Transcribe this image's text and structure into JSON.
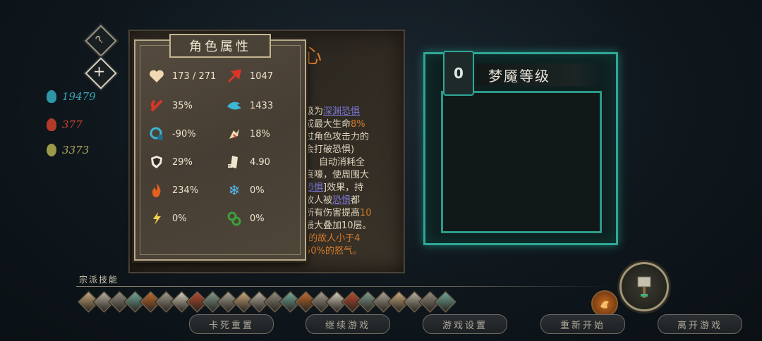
{
  "help_label": "?",
  "close_label": "✕",
  "currencies": [
    {
      "icon": "blue-flame-icon",
      "value": "19479",
      "color": "#39a7b8"
    },
    {
      "icon": "red-flame-icon",
      "value": "377",
      "color": "#c8432f"
    },
    {
      "icon": "green-spiral-icon",
      "value": "3373",
      "color": "#b3ad5b"
    }
  ],
  "background_text": {
    "title_char": "心",
    "lines": [
      {
        "pre": "级为",
        "hl": "深渊恐惧",
        "hl_type": "blue",
        "post": ""
      },
      {
        "pre": "成最大生命",
        "hl": "8%",
        "hl_type": "orange",
        "post": ""
      },
      {
        "pre": "过角色攻击力的",
        "hl": "",
        "hl_type": "",
        "post": ""
      },
      {
        "pre": "会打破恐惧)",
        "hl": "",
        "hl_type": "",
        "post": ""
      },
      {
        "pre": "自动消耗全",
        "hl": "",
        "hl_type": "",
        "post": ""
      },
      {
        "pre": "哀嚎，使周围大",
        "hl": "",
        "hl_type": "",
        "post": ""
      },
      {
        "pre": "",
        "hl": "恐惧",
        "hl_type": "blue",
        "post": "]效果，持"
      },
      {
        "pre": "故人被",
        "hl": "恐惧",
        "hl_type": "blue",
        "post": "都"
      },
      {
        "pre": "所有伤害提高",
        "hl": "10",
        "hl_type": "orange",
        "post": ""
      },
      {
        "pre": "最大叠加10层。",
        "hl": "",
        "hl_type": "",
        "post": ""
      },
      {
        "pre": "",
        "hl": "]的故人小于4",
        "hl_type": "orange",
        "post": ""
      },
      {
        "pre": "",
        "hl": "50%的怒气。",
        "hl_type": "orange",
        "post": ""
      }
    ]
  },
  "attributes": {
    "title": "角色属性",
    "stats": [
      {
        "icon": "heart-icon",
        "value": "173 / 271"
      },
      {
        "icon": "attack-icon",
        "value": "1047"
      },
      {
        "icon": "crit-rate-icon",
        "value": "35%"
      },
      {
        "icon": "crit-damage-icon",
        "value": "1433"
      },
      {
        "icon": "cooldown-icon",
        "value": "-90%"
      },
      {
        "icon": "lifesteal-icon",
        "value": "18%"
      },
      {
        "icon": "shield-icon",
        "value": "29%"
      },
      {
        "icon": "scroll-icon",
        "value": "4.90"
      },
      {
        "icon": "fire-icon",
        "value": "234%"
      },
      {
        "icon": "ice-icon",
        "value": "0%"
      },
      {
        "icon": "lightning-icon",
        "value": "0%"
      },
      {
        "icon": "poison-icon",
        "value": "0%"
      }
    ]
  },
  "nightmare": {
    "level": "0",
    "title": "梦魇等级"
  },
  "skills": {
    "label": "宗派技能",
    "count": 24
  },
  "buttons": {
    "reset_stuck": "卡死重置",
    "continue": "继续游戏",
    "settings": "游戏设置",
    "restart": "重新开始",
    "leave": "离开游戏"
  },
  "colors": {
    "accent_green": "#2fa796",
    "parchment": "#4a4236",
    "orange_highlight": "#d77b2a",
    "blue_highlight": "#7c77d6"
  }
}
